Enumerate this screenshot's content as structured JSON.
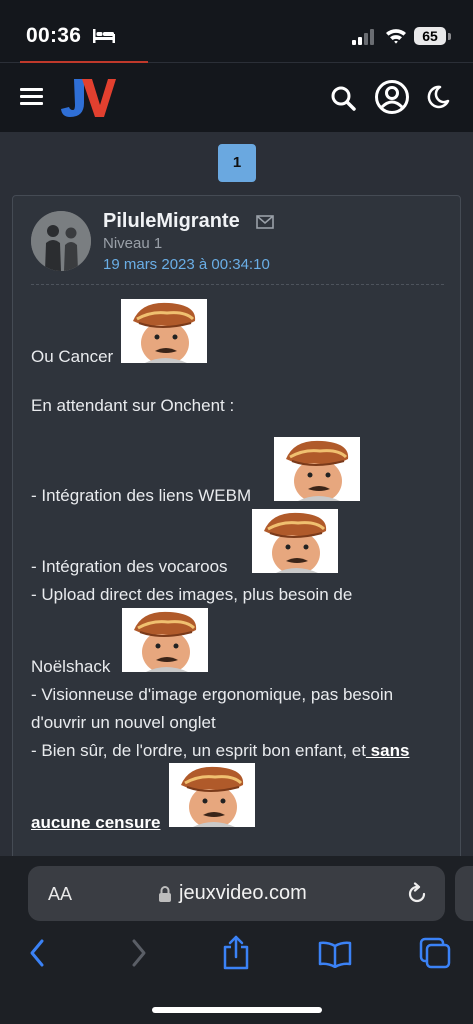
{
  "status": {
    "time": "00:36",
    "battery": "65"
  },
  "pagination": {
    "current_page": "1"
  },
  "post": {
    "author": "PiluleMigrante",
    "level": "Niveau 1",
    "date": "19 mars 2023 à 00:34:10",
    "lines": {
      "l1": "Ou Cancer",
      "l2": "En attendant sur Onchent :",
      "l3": "- Intégration des liens WEBM",
      "l4": "- Intégration des vocaroos",
      "l5": "- Upload direct des images, plus besoin de",
      "l6": "Noëlshack",
      "l7": "- Visionneuse d'image ergonomique, pas besoin",
      "l8": "d'ouvrir un nouvel onglet",
      "l9": "- Bien sûr, de l'ordre, un esprit bon enfant, et",
      "l9_bold": " sans",
      "l10_bold": "aucune censure"
    }
  },
  "browser": {
    "text_size_label": "AA",
    "url": "jeuxvideo.com"
  },
  "icons": [
    "bed-icon",
    "signal-icon",
    "wifi-icon",
    "hamburger-icon",
    "search-icon",
    "account-icon",
    "moon-icon",
    "mail-icon",
    "lock-icon",
    "reload-icon",
    "back-icon",
    "forward-icon",
    "share-icon",
    "bookmarks-icon",
    "tabs-icon"
  ],
  "colors": {
    "accent_blue": "#6aa8e0",
    "link_date": "#6aaee6",
    "logo_red": "#e2402f",
    "logo_blue": "#2f6fd6"
  }
}
